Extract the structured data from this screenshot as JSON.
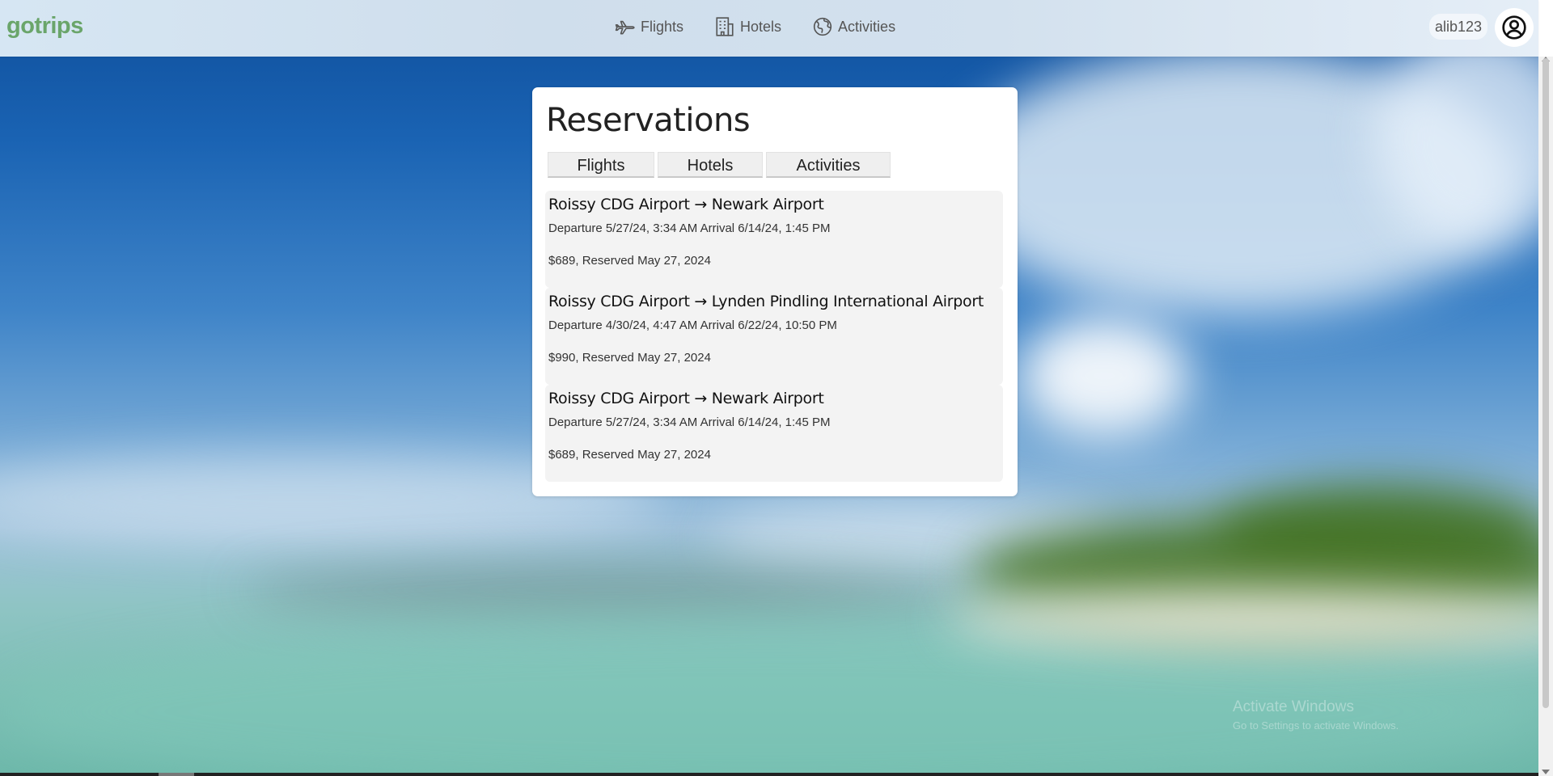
{
  "nav": {
    "logo": "gotrips",
    "links": [
      {
        "label": "Flights",
        "icon": "airplane-icon"
      },
      {
        "label": "Hotels",
        "icon": "hotel-building-icon"
      },
      {
        "label": "Activities",
        "icon": "globe-icon"
      }
    ],
    "username": "alib123",
    "avatar_icon": "user-circle-icon"
  },
  "reservations": {
    "title": "Reservations",
    "tabs": [
      {
        "label": "Flights"
      },
      {
        "label": "Hotels"
      },
      {
        "label": "Activities"
      }
    ],
    "items": [
      {
        "route": "Roissy CDG Airport → Newark Airport",
        "dates": "Departure 5/27/24, 3:34 AM Arrival 6/14/24, 1:45 PM",
        "price_reserved": "$689, Reserved May 27, 2024"
      },
      {
        "route": "Roissy CDG Airport → Lynden Pindling International Airport",
        "dates": "Departure 4/30/24, 4:47 AM Arrival 6/22/24, 10:50 PM",
        "price_reserved": "$990, Reserved May 27, 2024"
      },
      {
        "route": "Roissy CDG Airport → Newark Airport",
        "dates": "Departure 5/27/24, 3:34 AM Arrival 6/14/24, 1:45 PM",
        "price_reserved": "$689, Reserved May 27, 2024"
      }
    ]
  },
  "watermark": {
    "title": "Activate Windows",
    "subtitle": "Go to Settings to activate Windows."
  },
  "colors": {
    "logo_green": "#6aa56a",
    "nav_text": "#555555",
    "card_bg": "#ffffff",
    "item_bg": "#f3f3f3"
  }
}
